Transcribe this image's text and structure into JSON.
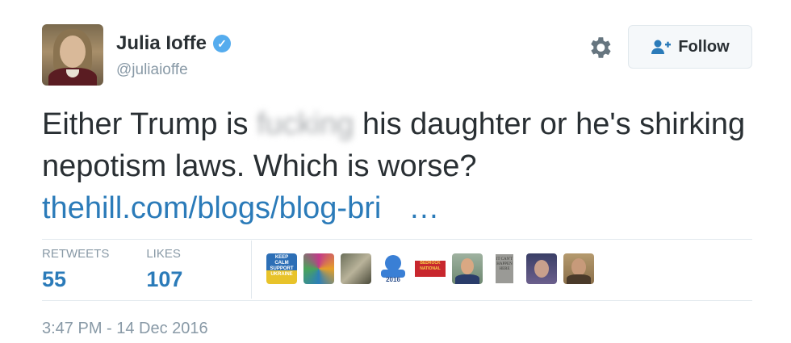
{
  "author": {
    "name": "Julia Ioffe",
    "handle": "@juliaioffe",
    "verified": true
  },
  "follow_button": {
    "label": "Follow",
    "icon": "add-user-icon"
  },
  "settings_icon": "gear-icon",
  "tweet": {
    "text_before": "Either Trump is ",
    "censored_word": "fucking",
    "text_after": " his daughter  or he's shirking nepotism laws. Which is worse?",
    "link": "thehill.com/blogs/blog-bri",
    "link_ellipsis": "…"
  },
  "stats": {
    "retweets_label": "RETWEETS",
    "retweets": "55",
    "likes_label": "LIKES",
    "likes": "107"
  },
  "likers": [
    {
      "text": [
        "KEEP",
        "CALM",
        "SUPPORT",
        "UKRAINE"
      ]
    },
    {
      "text": []
    },
    {
      "text": []
    },
    {
      "text": [
        "2016"
      ]
    },
    {
      "text": [
        "BEDROCK",
        "NATIONAL"
      ]
    },
    {
      "text": []
    },
    {
      "text": [
        "IT CAN'T",
        "HAPPEN",
        "HERE"
      ]
    },
    {
      "text": []
    },
    {
      "text": []
    }
  ],
  "timestamp": "3:47 PM - 14 Dec 2016",
  "colors": {
    "link": "#2b7bb9",
    "muted": "#8899a6",
    "verified": "#55acee",
    "text": "#292f33"
  }
}
